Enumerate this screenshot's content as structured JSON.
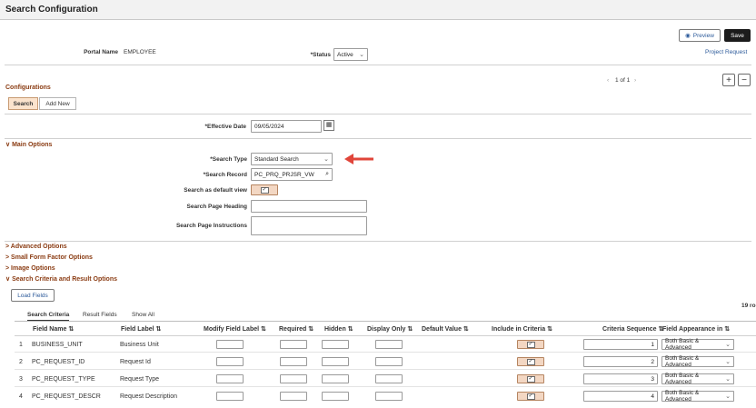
{
  "window": {
    "title": "Search Configuration"
  },
  "toolbar": {
    "preview_label": "Preview",
    "save_label": "Save"
  },
  "header": {
    "portal_label": "Portal Name",
    "portal_value": "EMPLOYEE",
    "status_label": "*Status",
    "status_value": "Active",
    "project_link": "Project Request"
  },
  "configurations": {
    "title": "Configurations",
    "pager": "1 of 1",
    "tabs": [
      "Search",
      "Add New"
    ],
    "effective_label": "*Effective Date",
    "effective_value": "09/05/2024"
  },
  "main_options": {
    "title": "Main Options",
    "search_type_label": "*Search Type",
    "search_type_value": "Standard Search",
    "search_record_label": "*Search Record",
    "search_record_value": "PC_PRQ_PRJSR_VW",
    "default_view_label": "Search as default view",
    "heading_label": "Search Page Heading",
    "instructions_label": "Search Page Instructions"
  },
  "collapsed_sections": [
    "Advanced Options",
    "Small Form Factor Options",
    "Image Options"
  ],
  "criteria": {
    "title": "Search Criteria and Result Options",
    "load_fields": "Load Fields",
    "rows_count": "19 ro",
    "subtabs": [
      "Search Criteria",
      "Result Fields",
      "Show All"
    ],
    "columns": [
      "Field Name",
      "Field Label",
      "Modify Field Label",
      "Required",
      "Hidden",
      "Display Only",
      "Default Value",
      "Include in Criteria",
      "Criteria Sequence",
      "Field Appearance in"
    ],
    "rows": [
      {
        "num": "1",
        "field": "BUSINESS_UNIT",
        "label": "Business Unit",
        "seq": "1",
        "appearance": "Both Basic & Advanced"
      },
      {
        "num": "2",
        "field": "PC_REQUEST_ID",
        "label": "Request Id",
        "seq": "2",
        "appearance": "Both Basic & Advanced"
      },
      {
        "num": "3",
        "field": "PC_REQUEST_TYPE",
        "label": "Request Type",
        "seq": "3",
        "appearance": "Both Basic & Advanced"
      },
      {
        "num": "4",
        "field": "PC_REQUEST_DESCR",
        "label": "Request Description",
        "seq": "4",
        "appearance": "Both Basic & Advanced"
      }
    ]
  },
  "colors": {
    "accent": "#8a3b12",
    "arrow": "#e0453a",
    "checkbox_on": "#f3d7c3"
  }
}
